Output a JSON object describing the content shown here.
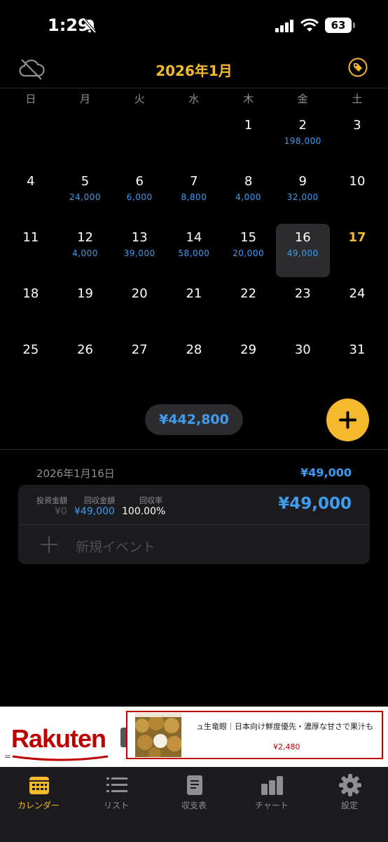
{
  "status_bar": {
    "time": "1:29",
    "battery": "63"
  },
  "header": {
    "title": "2026年1月"
  },
  "weekdays": [
    "日",
    "月",
    "火",
    "水",
    "木",
    "金",
    "土"
  ],
  "calendar": {
    "weeks": [
      [
        {
          "d": "",
          "a": ""
        },
        {
          "d": "",
          "a": ""
        },
        {
          "d": "",
          "a": ""
        },
        {
          "d": "",
          "a": ""
        },
        {
          "d": "1",
          "a": ""
        },
        {
          "d": "2",
          "a": "198,000"
        },
        {
          "d": "3",
          "a": ""
        }
      ],
      [
        {
          "d": "4",
          "a": ""
        },
        {
          "d": "5",
          "a": "24,000"
        },
        {
          "d": "6",
          "a": "6,000"
        },
        {
          "d": "7",
          "a": "8,800"
        },
        {
          "d": "8",
          "a": "4,000"
        },
        {
          "d": "9",
          "a": "32,000"
        },
        {
          "d": "10",
          "a": ""
        }
      ],
      [
        {
          "d": "11",
          "a": ""
        },
        {
          "d": "12",
          "a": "4,000"
        },
        {
          "d": "13",
          "a": "39,000"
        },
        {
          "d": "14",
          "a": "58,000"
        },
        {
          "d": "15",
          "a": "20,000"
        },
        {
          "d": "16",
          "a": "49,000",
          "selected": true
        },
        {
          "d": "17",
          "a": "",
          "today": true
        }
      ],
      [
        {
          "d": "18",
          "a": ""
        },
        {
          "d": "19",
          "a": ""
        },
        {
          "d": "20",
          "a": ""
        },
        {
          "d": "21",
          "a": ""
        },
        {
          "d": "22",
          "a": ""
        },
        {
          "d": "23",
          "a": ""
        },
        {
          "d": "24",
          "a": ""
        }
      ],
      [
        {
          "d": "25",
          "a": ""
        },
        {
          "d": "26",
          "a": ""
        },
        {
          "d": "27",
          "a": ""
        },
        {
          "d": "28",
          "a": ""
        },
        {
          "d": "29",
          "a": ""
        },
        {
          "d": "30",
          "a": ""
        },
        {
          "d": "31",
          "a": ""
        }
      ]
    ]
  },
  "month_total": "¥442,800",
  "detail": {
    "date": "2026年1月16日",
    "total": "¥49,000",
    "invest_label": "投資金額",
    "invest_value": "¥0",
    "return_label": "回収金額",
    "return_value": "¥49,000",
    "rate_label": "回収率",
    "rate_value": "100.00%",
    "amount": "¥49,000",
    "new_event": "新規イベント"
  },
  "ad": {
    "brand": "Rakuten",
    "title": "ュ生竜眼｜日本向け鮮度優先・濃厚な甘さで果汁も",
    "price": "¥2,480"
  },
  "tabs": [
    {
      "label": "カレンダー",
      "icon": "calendar-icon",
      "active": true
    },
    {
      "label": "リスト",
      "icon": "list-icon"
    },
    {
      "label": "収支表",
      "icon": "document-icon"
    },
    {
      "label": "チャート",
      "icon": "bar-chart-icon"
    },
    {
      "label": "設定",
      "icon": "gear-icon"
    }
  ],
  "colors": {
    "accent": "#f5b92e",
    "amount": "#3f9cf0",
    "background": "#000000",
    "ad_red": "#bf0000"
  }
}
